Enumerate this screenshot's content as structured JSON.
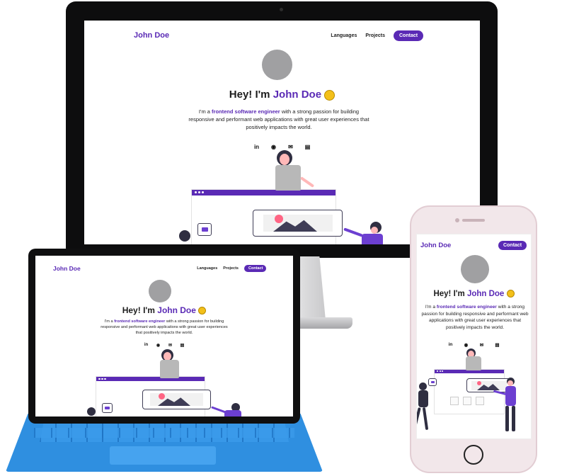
{
  "site": {
    "brand": "John Doe",
    "nav": {
      "languages": "Languages",
      "projects": "Projects",
      "contact": "Contact"
    },
    "hero": {
      "greeting": "Hey! I'm",
      "name": "John Doe",
      "wave_icon": "waving-hand-icon"
    },
    "bio": {
      "lead": "I'm a",
      "highlight": "frontend software engineer",
      "rest": "with a strong passion for building responsive and performant web applications with great user experiences that positively impacts the world."
    },
    "socials": [
      {
        "icon": "linkedin-icon",
        "glyph": "in"
      },
      {
        "icon": "github-icon",
        "glyph": "◉"
      },
      {
        "icon": "mail-icon",
        "glyph": "✉"
      },
      {
        "icon": "resume-icon",
        "glyph": "▤"
      }
    ]
  },
  "colors": {
    "accent": "#5a2ab5",
    "illustration_dark": "#3f3d56",
    "illustration_pink": "#ff6584",
    "keyboard_blue": "#2f8fe0"
  }
}
